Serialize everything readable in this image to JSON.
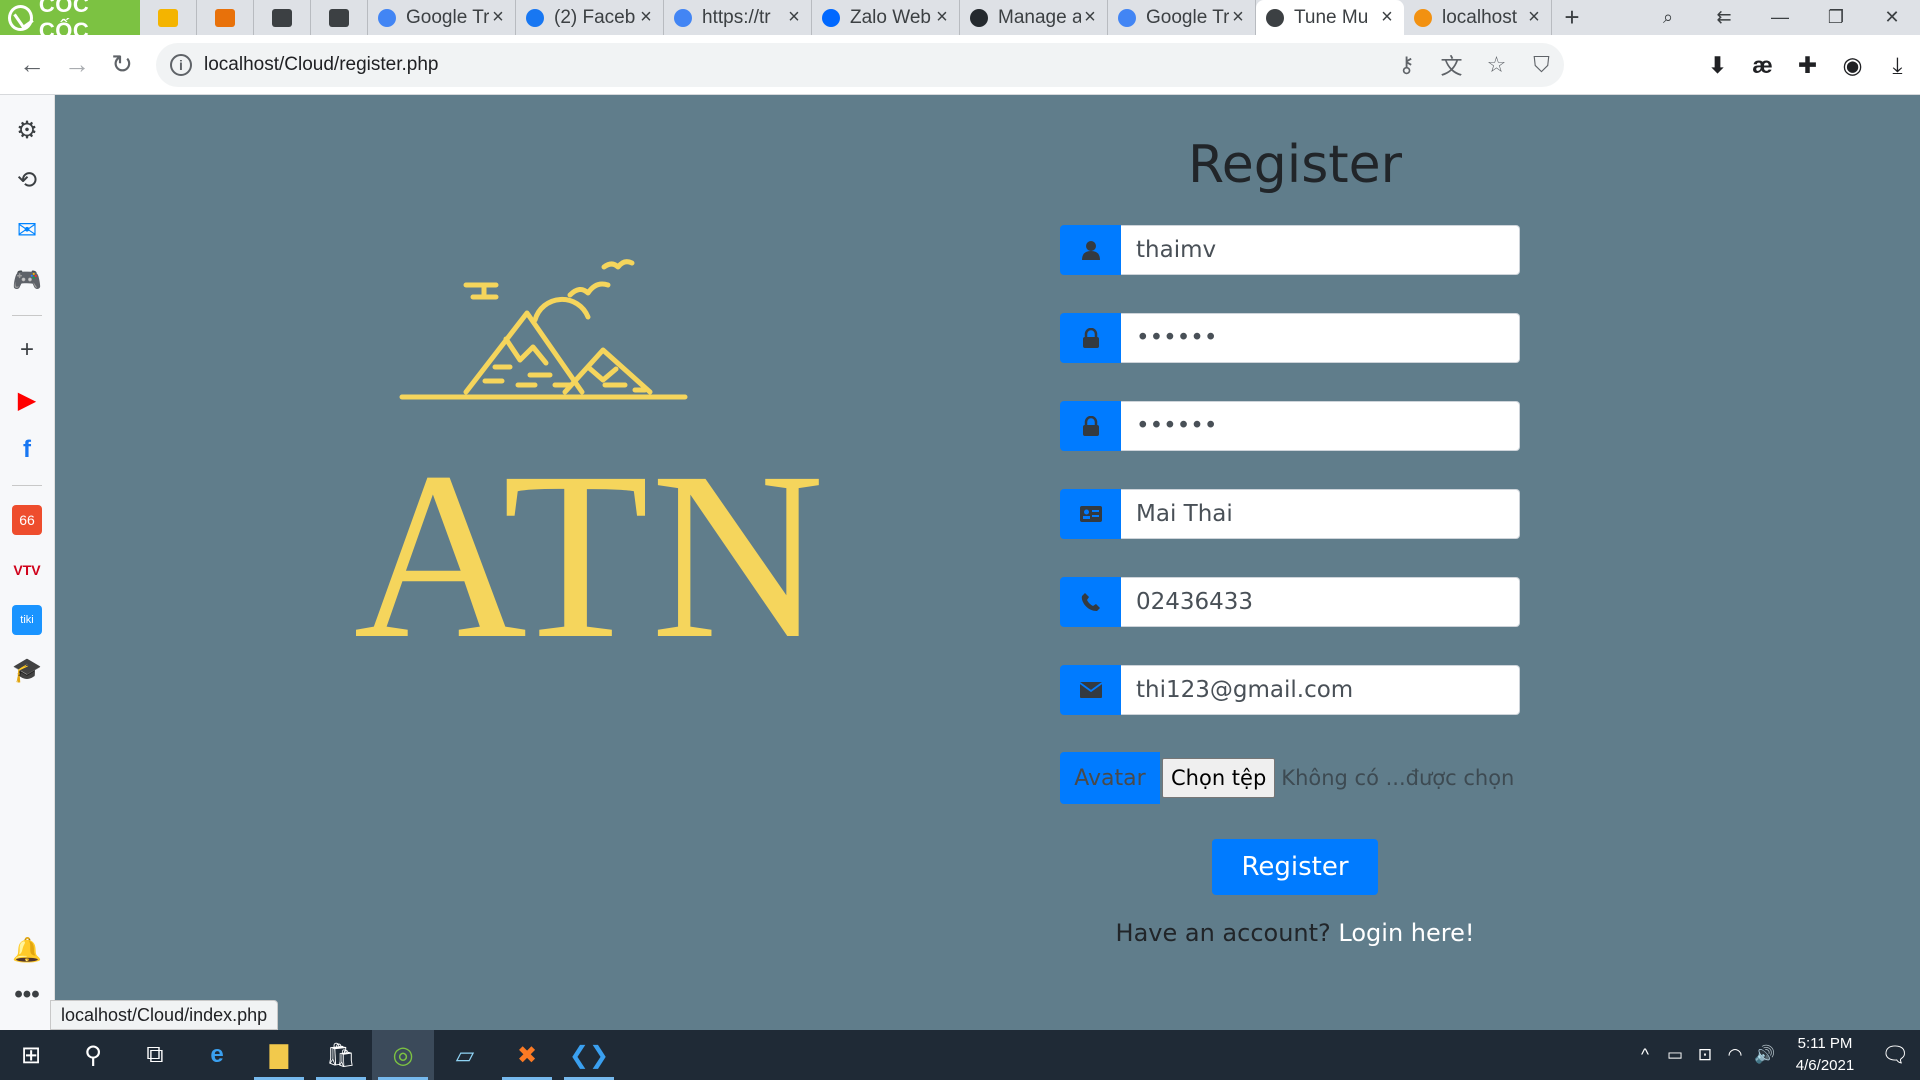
{
  "browser": {
    "brand": "CỐC CỐC",
    "tabs": [
      {
        "title": "Google Tr",
        "favicon_color": "#4285f4"
      },
      {
        "title": "(2) Faceb",
        "favicon_color": "#1877f2"
      },
      {
        "title": "https://tr",
        "favicon_color": "#4285f4"
      },
      {
        "title": "Zalo Web",
        "favicon_color": "#0068ff"
      },
      {
        "title": "Manage a",
        "favicon_color": "#24292e"
      },
      {
        "title": "Google Tr",
        "favicon_color": "#4285f4"
      },
      {
        "title": "Tune Mu",
        "favicon_color": "#3c4043",
        "active": true
      },
      {
        "title": "localhost",
        "favicon_color": "#f29111"
      }
    ],
    "pinned_tab_colors": [
      "#f4b400",
      "#e8710a",
      "#3c4043",
      "#3c4043"
    ],
    "url": "localhost/Cloud/register.php",
    "status_url": "localhost/Cloud/index.php"
  },
  "page": {
    "logo_text": "ATN",
    "form": {
      "title": "Register",
      "username": "thaimv",
      "password": "••••••",
      "confirm_password": "••••••",
      "fullname": "Mai Thai",
      "phone": "02436433",
      "email": "thi123@gmail.com",
      "avatar_label": "Avatar",
      "choose_file": "Chọn tệp",
      "no_file": "Không có ...được chọn",
      "submit": "Register",
      "have_account": "Have an account?",
      "login_link": "Login here!"
    },
    "colors": {
      "background": "#607d8b",
      "logo": "#f5d55c",
      "primary": "#007bff"
    }
  },
  "taskbar": {
    "time": "5:11 PM",
    "date": "4/6/2021"
  }
}
